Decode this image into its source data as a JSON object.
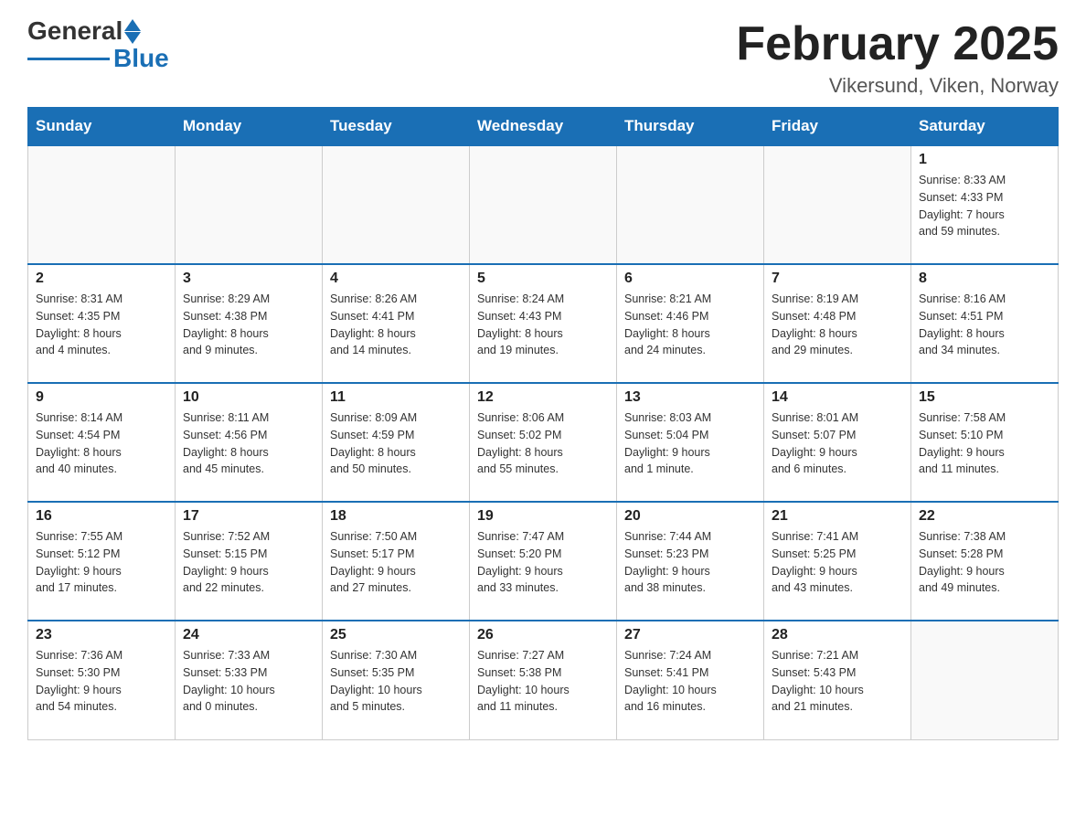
{
  "header": {
    "logo": {
      "text_general": "General",
      "text_blue": "Blue"
    },
    "title": "February 2025",
    "location": "Vikersund, Viken, Norway"
  },
  "weekdays": [
    "Sunday",
    "Monday",
    "Tuesday",
    "Wednesday",
    "Thursday",
    "Friday",
    "Saturday"
  ],
  "weeks": [
    [
      {
        "day": "",
        "info": ""
      },
      {
        "day": "",
        "info": ""
      },
      {
        "day": "",
        "info": ""
      },
      {
        "day": "",
        "info": ""
      },
      {
        "day": "",
        "info": ""
      },
      {
        "day": "",
        "info": ""
      },
      {
        "day": "1",
        "info": "Sunrise: 8:33 AM\nSunset: 4:33 PM\nDaylight: 7 hours\nand 59 minutes."
      }
    ],
    [
      {
        "day": "2",
        "info": "Sunrise: 8:31 AM\nSunset: 4:35 PM\nDaylight: 8 hours\nand 4 minutes."
      },
      {
        "day": "3",
        "info": "Sunrise: 8:29 AM\nSunset: 4:38 PM\nDaylight: 8 hours\nand 9 minutes."
      },
      {
        "day": "4",
        "info": "Sunrise: 8:26 AM\nSunset: 4:41 PM\nDaylight: 8 hours\nand 14 minutes."
      },
      {
        "day": "5",
        "info": "Sunrise: 8:24 AM\nSunset: 4:43 PM\nDaylight: 8 hours\nand 19 minutes."
      },
      {
        "day": "6",
        "info": "Sunrise: 8:21 AM\nSunset: 4:46 PM\nDaylight: 8 hours\nand 24 minutes."
      },
      {
        "day": "7",
        "info": "Sunrise: 8:19 AM\nSunset: 4:48 PM\nDaylight: 8 hours\nand 29 minutes."
      },
      {
        "day": "8",
        "info": "Sunrise: 8:16 AM\nSunset: 4:51 PM\nDaylight: 8 hours\nand 34 minutes."
      }
    ],
    [
      {
        "day": "9",
        "info": "Sunrise: 8:14 AM\nSunset: 4:54 PM\nDaylight: 8 hours\nand 40 minutes."
      },
      {
        "day": "10",
        "info": "Sunrise: 8:11 AM\nSunset: 4:56 PM\nDaylight: 8 hours\nand 45 minutes."
      },
      {
        "day": "11",
        "info": "Sunrise: 8:09 AM\nSunset: 4:59 PM\nDaylight: 8 hours\nand 50 minutes."
      },
      {
        "day": "12",
        "info": "Sunrise: 8:06 AM\nSunset: 5:02 PM\nDaylight: 8 hours\nand 55 minutes."
      },
      {
        "day": "13",
        "info": "Sunrise: 8:03 AM\nSunset: 5:04 PM\nDaylight: 9 hours\nand 1 minute."
      },
      {
        "day": "14",
        "info": "Sunrise: 8:01 AM\nSunset: 5:07 PM\nDaylight: 9 hours\nand 6 minutes."
      },
      {
        "day": "15",
        "info": "Sunrise: 7:58 AM\nSunset: 5:10 PM\nDaylight: 9 hours\nand 11 minutes."
      }
    ],
    [
      {
        "day": "16",
        "info": "Sunrise: 7:55 AM\nSunset: 5:12 PM\nDaylight: 9 hours\nand 17 minutes."
      },
      {
        "day": "17",
        "info": "Sunrise: 7:52 AM\nSunset: 5:15 PM\nDaylight: 9 hours\nand 22 minutes."
      },
      {
        "day": "18",
        "info": "Sunrise: 7:50 AM\nSunset: 5:17 PM\nDaylight: 9 hours\nand 27 minutes."
      },
      {
        "day": "19",
        "info": "Sunrise: 7:47 AM\nSunset: 5:20 PM\nDaylight: 9 hours\nand 33 minutes."
      },
      {
        "day": "20",
        "info": "Sunrise: 7:44 AM\nSunset: 5:23 PM\nDaylight: 9 hours\nand 38 minutes."
      },
      {
        "day": "21",
        "info": "Sunrise: 7:41 AM\nSunset: 5:25 PM\nDaylight: 9 hours\nand 43 minutes."
      },
      {
        "day": "22",
        "info": "Sunrise: 7:38 AM\nSunset: 5:28 PM\nDaylight: 9 hours\nand 49 minutes."
      }
    ],
    [
      {
        "day": "23",
        "info": "Sunrise: 7:36 AM\nSunset: 5:30 PM\nDaylight: 9 hours\nand 54 minutes."
      },
      {
        "day": "24",
        "info": "Sunrise: 7:33 AM\nSunset: 5:33 PM\nDaylight: 10 hours\nand 0 minutes."
      },
      {
        "day": "25",
        "info": "Sunrise: 7:30 AM\nSunset: 5:35 PM\nDaylight: 10 hours\nand 5 minutes."
      },
      {
        "day": "26",
        "info": "Sunrise: 7:27 AM\nSunset: 5:38 PM\nDaylight: 10 hours\nand 11 minutes."
      },
      {
        "day": "27",
        "info": "Sunrise: 7:24 AM\nSunset: 5:41 PM\nDaylight: 10 hours\nand 16 minutes."
      },
      {
        "day": "28",
        "info": "Sunrise: 7:21 AM\nSunset: 5:43 PM\nDaylight: 10 hours\nand 21 minutes."
      },
      {
        "day": "",
        "info": ""
      }
    ]
  ]
}
